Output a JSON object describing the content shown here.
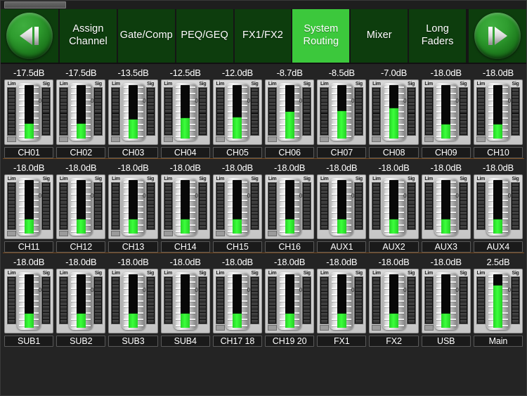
{
  "window": {
    "title_chip": ""
  },
  "navbar": {
    "prev_button": {
      "name": "previous-page",
      "glyph": "prev"
    },
    "next_button": {
      "name": "next-page",
      "glyph": "next"
    },
    "tabs": [
      {
        "label": "Assign\nChannel",
        "active": false
      },
      {
        "label": "Gate/Comp",
        "active": false
      },
      {
        "label": "PEQ/GEQ",
        "active": false
      },
      {
        "label": "FX1/FX2",
        "active": false
      },
      {
        "label": "System\nRouting",
        "active": true
      },
      {
        "label": "Mixer",
        "active": false
      },
      {
        "label": "Long\nFaders",
        "active": false
      }
    ],
    "active_tab": "System Routing",
    "colors": {
      "tab_bg": "#0d3d0d",
      "tab_active_bg": "#3cc83c",
      "bar_bg": "#0d2c0d"
    }
  },
  "meters": {
    "lim_label": "Lim",
    "sig_label": "Sig",
    "zero_label": "0",
    "led_count": 13,
    "fader_tick_count": 9
  },
  "colors": {
    "fader_fill": "#3bff3b",
    "row_divider": "#7a4a1c",
    "background": "#242424",
    "label_text": "#ffffff"
  },
  "rows": [
    {
      "channels": [
        {
          "name": "CH01",
          "db": "-17.5dB",
          "level_pct": 27,
          "has_foot": true
        },
        {
          "name": "CH02",
          "db": "-17.5dB",
          "level_pct": 27,
          "has_foot": true
        },
        {
          "name": "CH03",
          "db": "-13.5dB",
          "level_pct": 36,
          "has_foot": true
        },
        {
          "name": "CH04",
          "db": "-12.5dB",
          "level_pct": 38,
          "has_foot": true
        },
        {
          "name": "CH05",
          "db": "-12.0dB",
          "level_pct": 40,
          "has_foot": true
        },
        {
          "name": "CH06",
          "db": "-8.7dB",
          "level_pct": 50,
          "has_foot": true
        },
        {
          "name": "CH07",
          "db": "-8.5dB",
          "level_pct": 51,
          "has_foot": true
        },
        {
          "name": "CH08",
          "db": "-7.0dB",
          "level_pct": 56,
          "has_foot": true
        },
        {
          "name": "CH09",
          "db": "-18.0dB",
          "level_pct": 26,
          "has_foot": true
        },
        {
          "name": "CH10",
          "db": "-18.0dB",
          "level_pct": 26,
          "has_foot": true
        }
      ]
    },
    {
      "channels": [
        {
          "name": "CH11",
          "db": "-18.0dB",
          "level_pct": 26,
          "has_foot": true
        },
        {
          "name": "CH12",
          "db": "-18.0dB",
          "level_pct": 26,
          "has_foot": true
        },
        {
          "name": "CH13",
          "db": "-18.0dB",
          "level_pct": 26,
          "has_foot": true
        },
        {
          "name": "CH14",
          "db": "-18.0dB",
          "level_pct": 26,
          "has_foot": true
        },
        {
          "name": "CH15",
          "db": "-18.0dB",
          "level_pct": 26,
          "has_foot": true
        },
        {
          "name": "CH16",
          "db": "-18.0dB",
          "level_pct": 26,
          "has_foot": true
        },
        {
          "name": "AUX1",
          "db": "-18.0dB",
          "level_pct": 26,
          "has_foot": false
        },
        {
          "name": "AUX2",
          "db": "-18.0dB",
          "level_pct": 26,
          "has_foot": false
        },
        {
          "name": "AUX3",
          "db": "-18.0dB",
          "level_pct": 26,
          "has_foot": false
        },
        {
          "name": "AUX4",
          "db": "-18.0dB",
          "level_pct": 26,
          "has_foot": false
        }
      ]
    },
    {
      "channels": [
        {
          "name": "SUB1",
          "db": "-18.0dB",
          "level_pct": 26,
          "has_foot": false
        },
        {
          "name": "SUB2",
          "db": "-18.0dB",
          "level_pct": 26,
          "has_foot": false
        },
        {
          "name": "SUB3",
          "db": "-18.0dB",
          "level_pct": 26,
          "has_foot": false
        },
        {
          "name": "SUB4",
          "db": "-18.0dB",
          "level_pct": 26,
          "has_foot": false
        },
        {
          "name": "CH17  18",
          "db": "-18.0dB",
          "level_pct": 26,
          "has_foot": true
        },
        {
          "name": "CH19  20",
          "db": "-18.0dB",
          "level_pct": 26,
          "has_foot": true
        },
        {
          "name": "FX1",
          "db": "-18.0dB",
          "level_pct": 26,
          "has_foot": true
        },
        {
          "name": "FX2",
          "db": "-18.0dB",
          "level_pct": 26,
          "has_foot": true
        },
        {
          "name": "USB",
          "db": "-18.0dB",
          "level_pct": 26,
          "has_foot": true
        },
        {
          "name": "Main",
          "db": "2.5dB",
          "level_pct": 78,
          "has_foot": false
        }
      ]
    }
  ]
}
